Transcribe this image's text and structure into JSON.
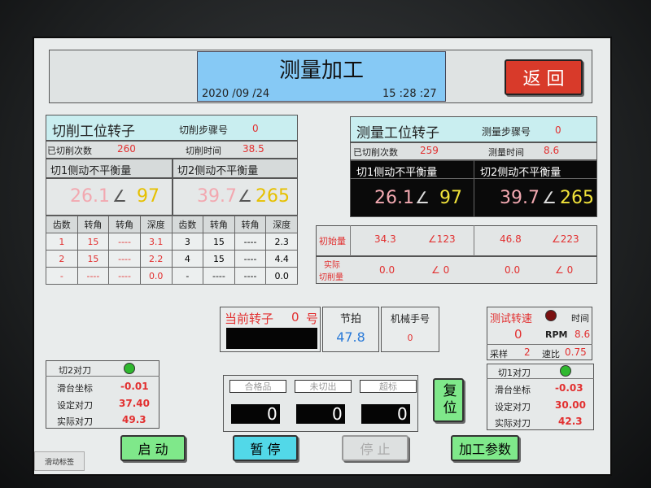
{
  "header": {
    "title": "测量加工",
    "date": "2020 /09 /24",
    "time": "15 :28 :27",
    "back_label": "返 回"
  },
  "cut_station": {
    "title": "切削工位转子",
    "step_label": "切削步骤号",
    "step_value": "0",
    "count_label": "已切削次数",
    "count_value": "260",
    "time_label": "切削时间",
    "time_value": "38.5",
    "side1_label": "切1侧动不平衡量",
    "side2_label": "切2侧动不平衡量",
    "side1_mag": "26.1",
    "side1_ang": "97",
    "side2_mag": "39.7",
    "side2_ang": "265",
    "angle_symbol": "∠",
    "table": {
      "headers": [
        "齿数",
        "转角",
        "转角",
        "深度",
        "齿数",
        "转角",
        "转角",
        "深度"
      ],
      "rows": [
        [
          "1",
          "15",
          "----",
          "3.1",
          "3",
          "15",
          "----",
          "2.3"
        ],
        [
          "2",
          "15",
          "----",
          "2.2",
          "4",
          "15",
          "----",
          "4.4"
        ],
        [
          "-",
          "----",
          "----",
          "0.0",
          "-",
          "----",
          "----",
          "0.0"
        ]
      ]
    }
  },
  "measure_station": {
    "title": "测量工位转子",
    "step_label": "测量步骤号",
    "step_value": "0",
    "count_label": "已切削次数",
    "count_value": "259",
    "time_label": "测量时间",
    "time_value": "8.6",
    "side1_label": "切1侧动不平衡量",
    "side2_label": "切2侧动不平衡量",
    "side1_mag": "26.1",
    "side1_ang": "97",
    "side2_mag": "39.7",
    "side2_ang": "265",
    "angle_symbol": "∠",
    "initial_label": "初始量",
    "initial_1_mag": "34.3",
    "initial_1_ang": "∠123",
    "initial_2_mag": "46.8",
    "initial_2_ang": "∠223",
    "actual_label_1": "实际",
    "actual_label_2": "切削量",
    "actual_1_mag": "0.0",
    "actual_1_ang": "∠  0",
    "actual_2_mag": "0.0",
    "actual_2_ang": "∠  0"
  },
  "current_rotor": {
    "label": "当前转子",
    "value": "0",
    "unit": "号"
  },
  "beat": {
    "label": "节拍",
    "value": "47.8"
  },
  "robot": {
    "label": "机械手号",
    "value": "0"
  },
  "speed": {
    "label": "测试转速",
    "time_label": "时间",
    "rpm_value": "0",
    "rpm_unit": "RPM",
    "time_value": "8.6",
    "sample_label": "采样",
    "sample_value": "2",
    "ratio_label": "速比",
    "ratio_value": "0.75",
    "indicator_color": "#7a1010"
  },
  "cut2_tool": {
    "title": "切2对刀",
    "slide_label": "滑台坐标",
    "slide_value": "-0.01",
    "set_label": "设定对刀",
    "set_value": "37.40",
    "actual_label": "实际对刀",
    "actual_value": "49.3",
    "indicator_color": "#2fb82f"
  },
  "cut1_tool": {
    "title": "切1对刀",
    "slide_label": "滑台坐标",
    "slide_value": "-0.03",
    "set_label": "设定对刀",
    "set_value": "30.00",
    "actual_label": "实际对刀",
    "actual_value": "42.3",
    "indicator_color": "#2fb82f"
  },
  "counters": {
    "pass_label": "合格品",
    "uncut_label": "未切出",
    "over_label": "超标",
    "pass_value": "0",
    "uncut_value": "0",
    "over_value": "0"
  },
  "reset_label": "复位",
  "buttons": {
    "start": "启  动",
    "pause": "暂  停",
    "stop": "停  止",
    "params": "加工参数"
  },
  "footer_label": "滑动标签",
  "colors": {
    "header_blue": "#86c9f5",
    "cyan_panel": "#c9eef0",
    "green_button": "#7fe88a",
    "cyan_button": "#52d8e8",
    "back_button": "#d83a2a",
    "value_red": "#e23030",
    "angle_yellow": "#f0e23a"
  }
}
